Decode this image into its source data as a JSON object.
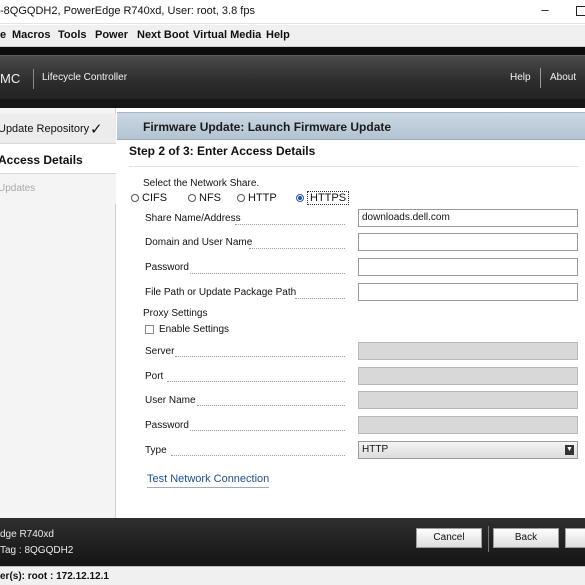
{
  "window": {
    "title": "-8QGQDH2, PowerEdge R740xd, User: root, 3.8 fps",
    "minimize_glyph": "–"
  },
  "menubar": {
    "items": [
      "Macros",
      "Tools",
      "Power",
      "Next Boot",
      "Virtual Media",
      "Help"
    ]
  },
  "header": {
    "brand": "MC",
    "app_name": "Lifecycle Controller",
    "help": "Help",
    "about": "About"
  },
  "sidebar": {
    "items": [
      {
        "label": "Update Repository",
        "state": "done",
        "check": "✓"
      },
      {
        "label": "Access Details",
        "state": "active"
      },
      {
        "label": "Updates",
        "state": "disabled"
      }
    ]
  },
  "panel": {
    "title": "Firmware Update: Launch Firmware Update",
    "step": "Step 2 of 3: Enter Access Details",
    "network_share_label": "Select the Network Share.",
    "share_options": [
      {
        "label": "CIFS",
        "selected": false
      },
      {
        "label": "NFS",
        "selected": false
      },
      {
        "label": "HTTP",
        "selected": false
      },
      {
        "label": "HTTPS",
        "selected": true
      }
    ],
    "fields": {
      "share_name": {
        "label": "Share Name/Address",
        "value": "downloads.dell.com"
      },
      "domain_user": {
        "label": "Domain and User Name",
        "value": ""
      },
      "password": {
        "label": "Password",
        "value": ""
      },
      "file_path": {
        "label": "File Path or Update Package Path",
        "value": ""
      }
    },
    "proxy": {
      "heading": "Proxy Settings",
      "enable_label": "Enable Settings",
      "enabled": false,
      "server": {
        "label": "Server",
        "value": ""
      },
      "port": {
        "label": "Port",
        "value": ""
      },
      "user": {
        "label": "User Name",
        "value": ""
      },
      "password": {
        "label": "Password",
        "value": ""
      },
      "type": {
        "label": "Type",
        "value": "HTTP"
      }
    },
    "test_link": "Test Network Connection"
  },
  "footer": {
    "model": "dge R740xd",
    "service_tag": " Tag : 8QGQDH2",
    "buttons": {
      "cancel": "Cancel",
      "back": "Back"
    }
  },
  "statusbar": {
    "text": "er(s): root : 172.12.12.1"
  },
  "colors": {
    "panel_header": "#b3c4d3",
    "link": "#1d4f91",
    "radio_selected": "#2a5aa8"
  }
}
